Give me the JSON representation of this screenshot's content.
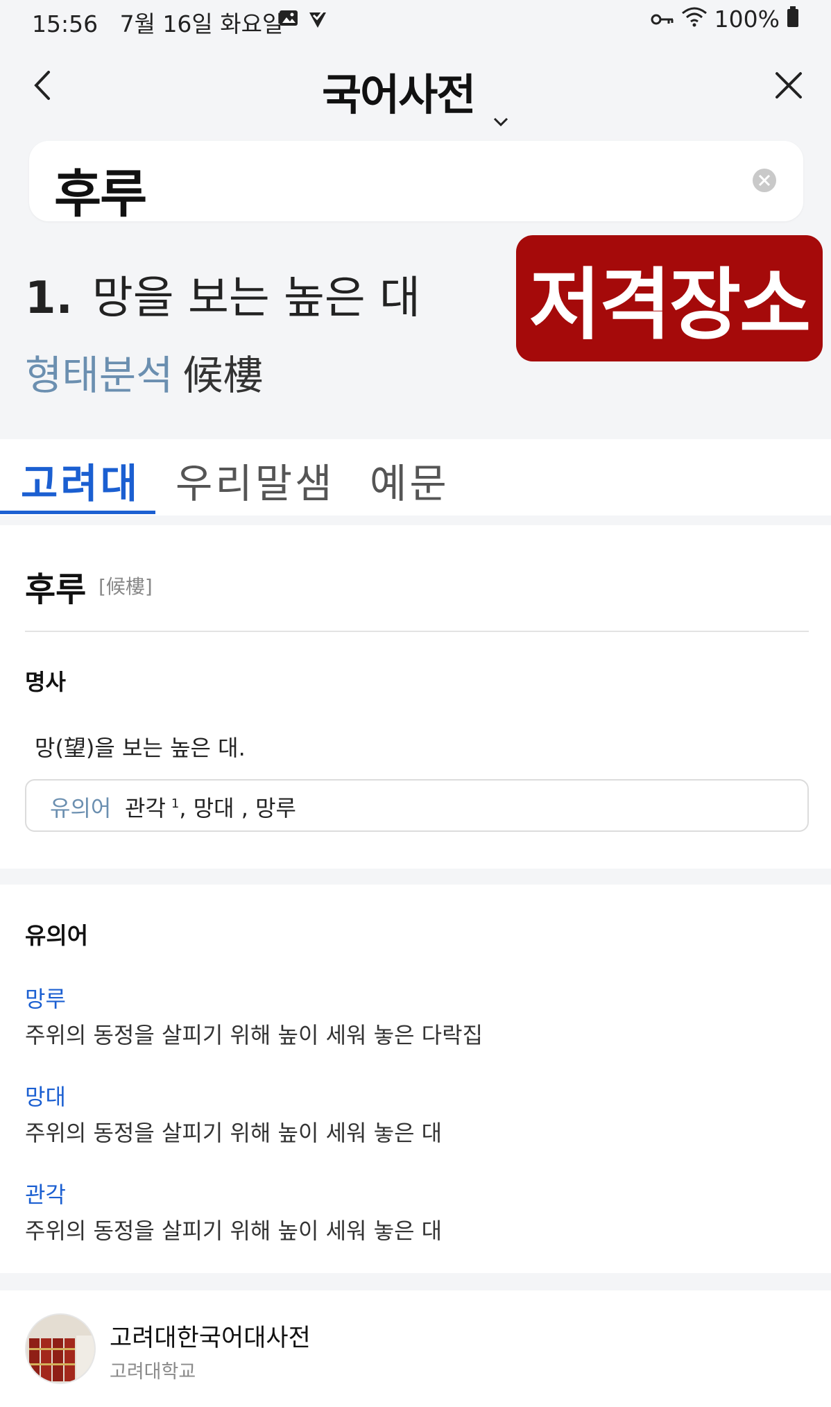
{
  "status_bar": {
    "time": "15:56",
    "date": "7월 16일 화요일",
    "battery": "100%"
  },
  "header": {
    "title": "국어사전",
    "back_icon": "chevron-left-icon",
    "close_icon": "close-icon",
    "dropdown_icon": "chevron-down-icon"
  },
  "search": {
    "value": "후루"
  },
  "summary": {
    "number": "1.",
    "definition": "망을 보는 높은 대",
    "morph_label": "형태분석",
    "morph_hanja": "候樓"
  },
  "stamp": {
    "text": "저격장소",
    "color": "#a50a0a"
  },
  "tabs": [
    {
      "label": "고려대",
      "active": true
    },
    {
      "label": "우리말샘",
      "active": false
    },
    {
      "label": "예문",
      "active": false
    }
  ],
  "entry": {
    "word": "후루",
    "hanja": "[候樓]",
    "pos": "명사",
    "meaning": "망(望)을 보는 높은 대.",
    "synonym_label": "유의어",
    "synonym_first": "관각",
    "synonym_first_sup": "1",
    "synonym_rest": ", 망대 , 망루"
  },
  "synonyms_section": {
    "title": "유의어",
    "items": [
      {
        "word": "망루",
        "desc": "주위의 동정을 살피기 위해 높이 세워 놓은 다락집"
      },
      {
        "word": "망대",
        "desc": "주위의 동정을 살피기 위해 높이 세워 놓은 대"
      },
      {
        "word": "관각",
        "desc": "주위의 동정을 살피기 위해 높이 세워 놓은 대"
      }
    ]
  },
  "source": {
    "name": "고려대한국어대사전",
    "org": "고려대학교"
  },
  "colors": {
    "accent": "#1b5fd1",
    "muted_blue": "#6b8fb0"
  }
}
